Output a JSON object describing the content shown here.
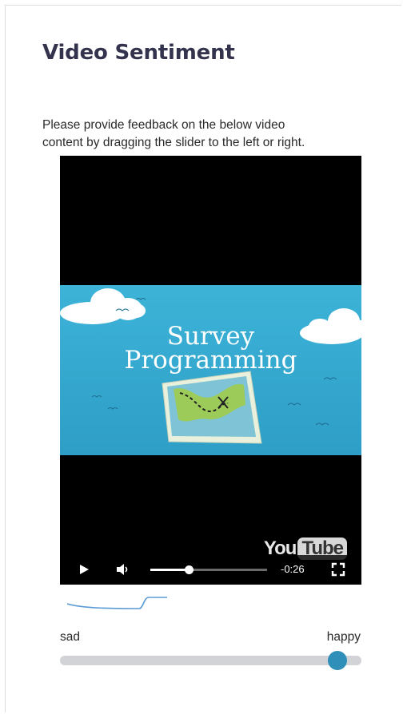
{
  "page": {
    "title": "Video Sentiment",
    "instructions_line1": "Please provide feedback on the below video",
    "instructions_line2": "content by dragging the slider to the left or right."
  },
  "video": {
    "thumbnail_title_line1": "Survey",
    "thumbnail_title_line2": "Programming",
    "logo_you": "You",
    "logo_tube": "Tube",
    "time_remaining": "-0:26",
    "progress": 0.33,
    "controls": {
      "play_icon": "play-icon",
      "volume_icon": "volume-icon",
      "fullscreen_icon": "fullscreen-icon"
    }
  },
  "sentiment": {
    "left_label": "sad",
    "right_label": "happy",
    "value": 0.92,
    "accent_color": "#2f8fb8",
    "trace_color": "#5b9bd5"
  }
}
